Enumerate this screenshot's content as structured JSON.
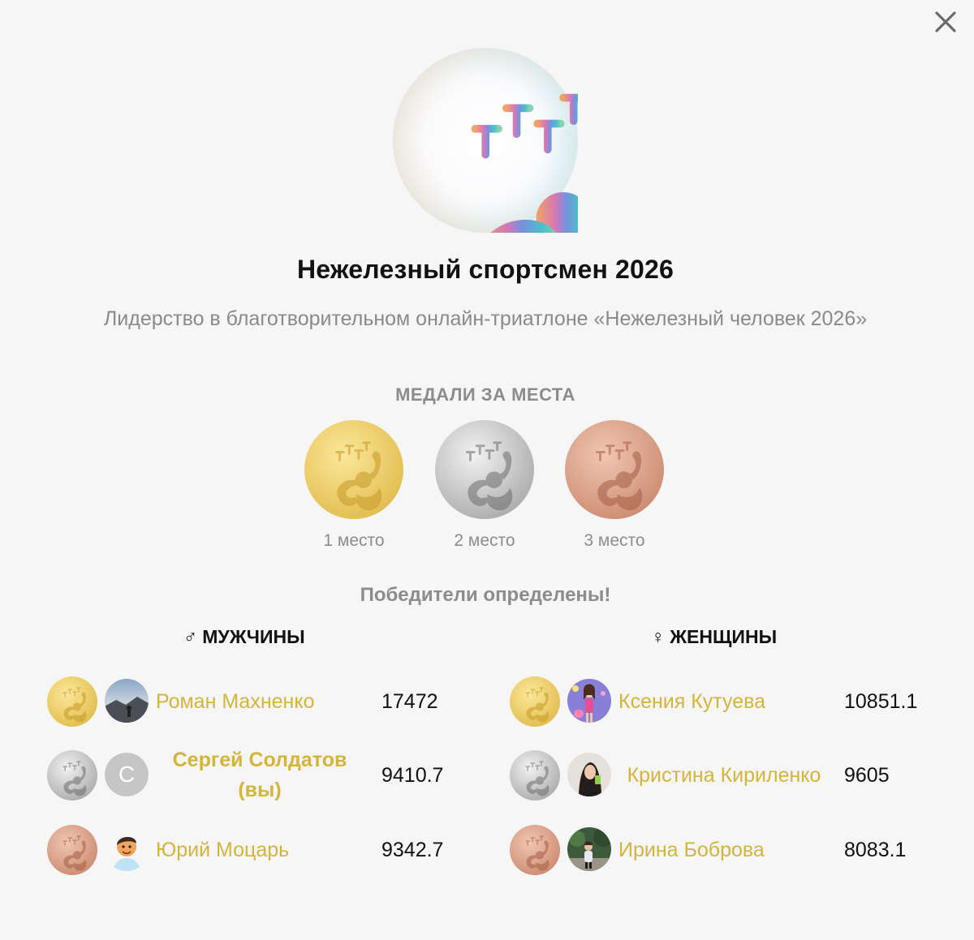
{
  "dialog": {
    "title": "Нежелезный спортсмен 2026",
    "description": "Лидерство в благотворительном онлайн-триатлоне «Нежелезный человек 2026»",
    "close_icon": "close-icon"
  },
  "medals": {
    "title": "МЕДАЛИ ЗА МЕСТА",
    "items": [
      {
        "label": "1 место",
        "color": "#e8c860"
      },
      {
        "label": "2 место",
        "color": "#bdbdbd"
      },
      {
        "label": "3 место",
        "color": "#d39a82"
      }
    ]
  },
  "winners": {
    "title": "Победители определены!",
    "men": {
      "symbol": "♂",
      "heading": "МУЖЧИНЫ",
      "rows": [
        {
          "name": "Роман Махненко",
          "score": "17472"
        },
        {
          "name": "Сергей Солдатов (вы)",
          "score": "9410.7",
          "avatar_letter": "С"
        },
        {
          "name": "Юрий Моцарь",
          "score": "9342.7"
        }
      ]
    },
    "women": {
      "symbol": "♀",
      "heading": "ЖЕНЩИНЫ",
      "rows": [
        {
          "name": "Ксения Кутуева",
          "score": "10851.1"
        },
        {
          "name": "Кристина Кириленко",
          "score": "9605"
        },
        {
          "name": "Ирина Боброва",
          "score": "8083.1"
        }
      ]
    }
  },
  "colors": {
    "name_link": "#d5b43a",
    "muted_text": "#8c8c8c",
    "background": "#f6f6f6"
  }
}
